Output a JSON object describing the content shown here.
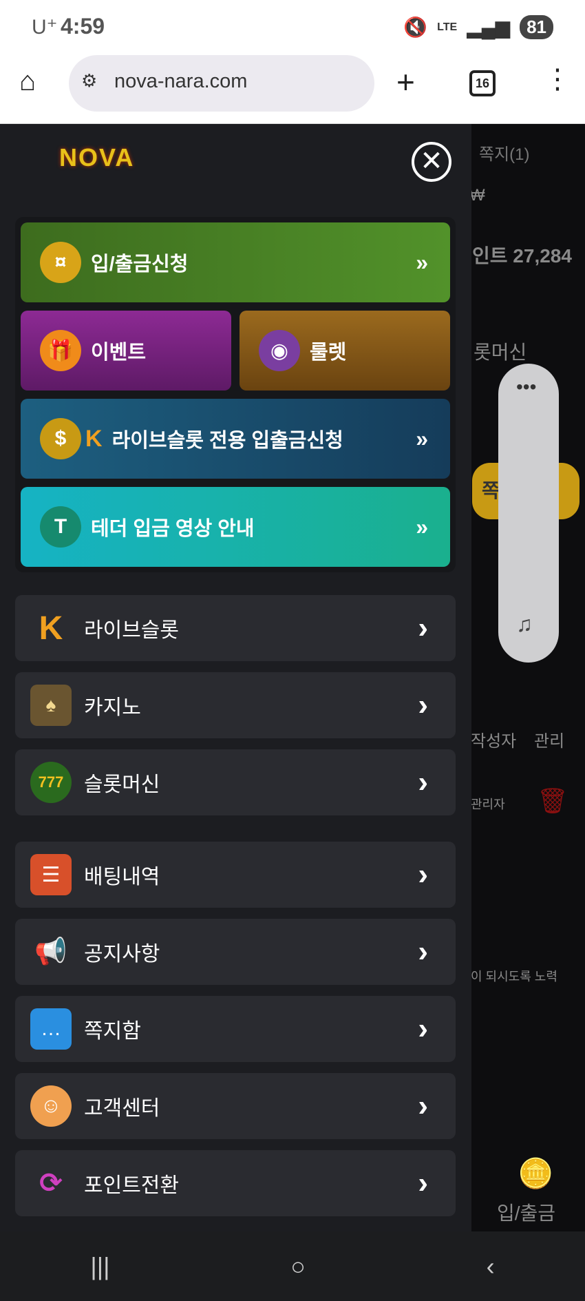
{
  "status": {
    "carrier": "U⁺",
    "time": "4:59",
    "battery": "81",
    "network": "LTE"
  },
  "browser": {
    "url": "nova-nara.com",
    "tab_count": "16"
  },
  "background": {
    "message_link": "쪽지(1)",
    "currency": "₩",
    "points": "인트 27,284",
    "slot_label": "롯머신",
    "col_author": "작성자",
    "col_manage": "관리",
    "admin": "관리자",
    "notice_snippet": "이 되시도록 노력",
    "bottom_tab": "입/출금",
    "yellow_btn": "쪽"
  },
  "drawer": {
    "logo": "NOVA",
    "quick": {
      "deposit": "입/출금신청",
      "event": "이벤트",
      "roulette": "룰렛",
      "liveslot_deposit": "라이브슬롯 전용 입출금신청",
      "tether_guide": "테더 입금 영상 안내"
    },
    "menu": [
      {
        "label": "라이브슬롯"
      },
      {
        "label": "카지노"
      },
      {
        "label": "슬롯머신"
      },
      {
        "label": "배팅내역"
      },
      {
        "label": "공지사항"
      },
      {
        "label": "쪽지함"
      },
      {
        "label": "고객센터"
      },
      {
        "label": "포인트전환"
      }
    ]
  },
  "colors": {
    "deposit_btn": "#3e7a1c",
    "event_btn": "#7a1f80",
    "roulette_btn": "#8a5a1a",
    "liveslot_btn": "#1a5a7a",
    "tether_btn": "#1bb5a8"
  }
}
